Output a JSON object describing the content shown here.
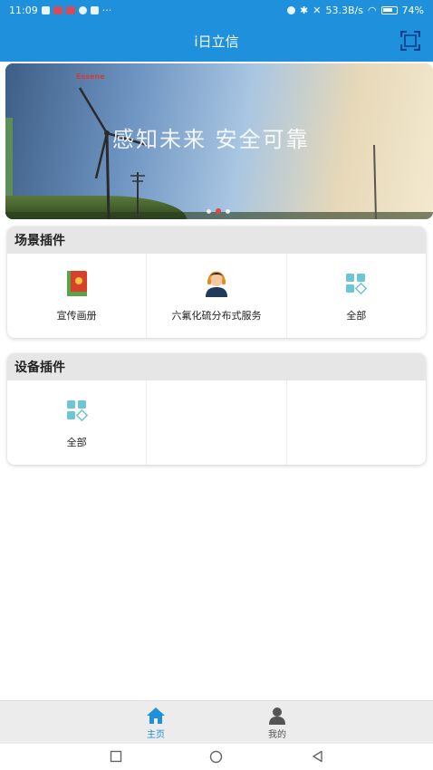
{
  "status_bar": {
    "time": "11:09",
    "ellipsis": "···",
    "net_speed": "53.3B/s",
    "battery": "74%"
  },
  "app_bar": {
    "title": "i日立信",
    "scan_icon": "scan-icon"
  },
  "banner": {
    "tagline": "感知未来  安全可靠",
    "logo_text": "Essene",
    "page_count": 3,
    "active_page": 2
  },
  "scene_plugins": {
    "title": "场景插件",
    "items": [
      {
        "label": "宣传画册",
        "icon": "brochure-icon"
      },
      {
        "label": "六氟化硫分布式服务",
        "icon": "service-agent-icon"
      },
      {
        "label": "全部",
        "icon": "all-grid-icon"
      }
    ]
  },
  "device_plugins": {
    "title": "设备插件",
    "items": [
      {
        "label": "全部",
        "icon": "all-grid-icon"
      }
    ]
  },
  "bottom_nav": {
    "items": [
      {
        "label": "主页",
        "icon": "home-icon",
        "active": true
      },
      {
        "label": "我的",
        "icon": "user-icon",
        "active": false
      }
    ]
  },
  "colors": {
    "primary": "#1e90dc",
    "card_header": "#e6e6e6",
    "nav_bg": "#ececec"
  }
}
